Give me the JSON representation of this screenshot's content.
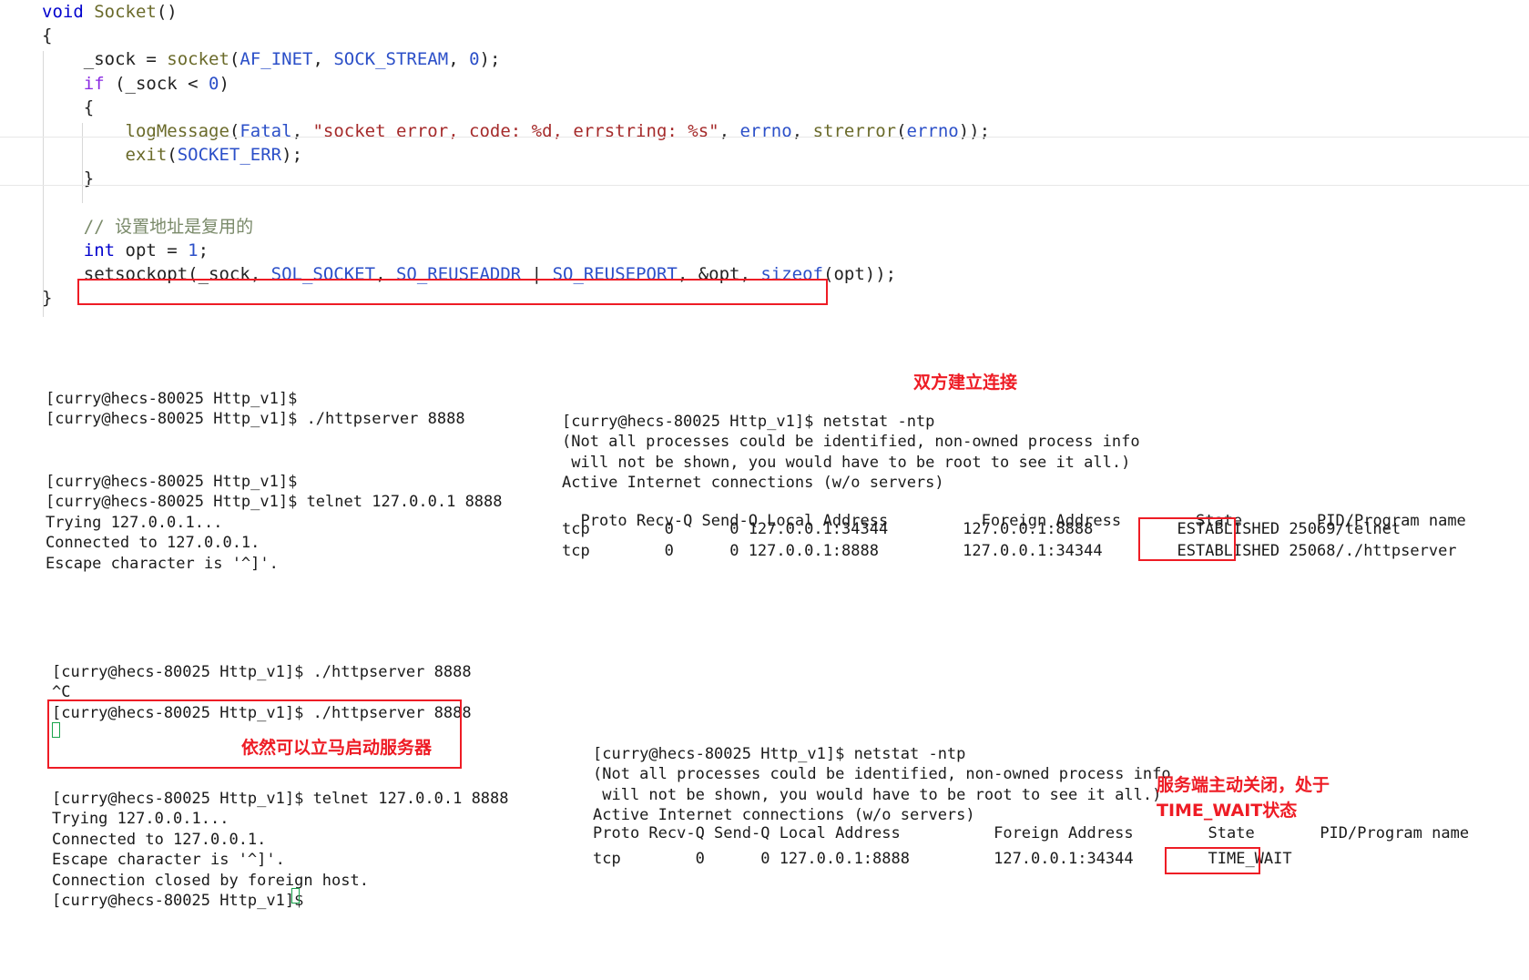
{
  "code": {
    "lines": [
      [
        {
          "t": "void ",
          "c": "kw"
        },
        {
          "t": "Socket",
          "c": "fn"
        },
        {
          "t": "()",
          "c": "punc"
        }
      ],
      [
        {
          "t": "{",
          "c": "punc"
        }
      ],
      [
        {
          "t": "    _sock = ",
          "c": "plain"
        },
        {
          "t": "socket",
          "c": "fn"
        },
        {
          "t": "(",
          "c": "punc"
        },
        {
          "t": "AF_INET",
          "c": "const"
        },
        {
          "t": ", ",
          "c": "punc"
        },
        {
          "t": "SOCK_STREAM",
          "c": "const"
        },
        {
          "t": ", ",
          "c": "punc"
        },
        {
          "t": "0",
          "c": "num"
        },
        {
          "t": ");",
          "c": "punc"
        }
      ],
      [
        {
          "t": "    ",
          "c": "plain"
        },
        {
          "t": "if",
          "c": "kw2"
        },
        {
          "t": " (_sock < ",
          "c": "plain"
        },
        {
          "t": "0",
          "c": "num"
        },
        {
          "t": ")",
          "c": "punc"
        }
      ],
      [
        {
          "t": "    {",
          "c": "punc"
        }
      ],
      [
        {
          "t": "        ",
          "c": "plain"
        },
        {
          "t": "logMessage",
          "c": "fn"
        },
        {
          "t": "(",
          "c": "punc"
        },
        {
          "t": "Fatal",
          "c": "const"
        },
        {
          "t": ", ",
          "c": "punc"
        },
        {
          "t": "\"socket error, code: %d, errstring: %s\"",
          "c": "str"
        },
        {
          "t": ", ",
          "c": "punc"
        },
        {
          "t": "errno",
          "c": "const"
        },
        {
          "t": ", ",
          "c": "punc"
        },
        {
          "t": "strerror",
          "c": "fn"
        },
        {
          "t": "(",
          "c": "punc"
        },
        {
          "t": "errno",
          "c": "const"
        },
        {
          "t": "));",
          "c": "punc"
        }
      ],
      [
        {
          "t": "        ",
          "c": "plain"
        },
        {
          "t": "exit",
          "c": "fn"
        },
        {
          "t": "(",
          "c": "punc"
        },
        {
          "t": "SOCKET_ERR",
          "c": "const"
        },
        {
          "t": ");",
          "c": "punc"
        }
      ],
      [
        {
          "t": "    }",
          "c": "punc"
        }
      ],
      [
        {
          "t": "",
          "c": "plain"
        }
      ],
      [
        {
          "t": "    // 设置地址是复用的",
          "c": "comment"
        }
      ],
      [
        {
          "t": "    ",
          "c": "plain"
        },
        {
          "t": "int",
          "c": "kw"
        },
        {
          "t": " opt = ",
          "c": "plain"
        },
        {
          "t": "1",
          "c": "num"
        },
        {
          "t": ";",
          "c": "punc"
        }
      ],
      [
        {
          "t": "    ",
          "c": "plain"
        },
        {
          "t": "setsockopt",
          "c": "plain"
        },
        {
          "t": "(_sock, ",
          "c": "punc"
        },
        {
          "t": "SOL_SOCKET",
          "c": "const"
        },
        {
          "t": ", ",
          "c": "punc"
        },
        {
          "t": "SO_REUSEADDR",
          "c": "const"
        },
        {
          "t": " | ",
          "c": "punc"
        },
        {
          "t": "SO_REUSEPORT",
          "c": "const"
        },
        {
          "t": ", &opt, ",
          "c": "punc"
        },
        {
          "t": "sizeof",
          "c": "const"
        },
        {
          "t": "(opt));",
          "c": "punc"
        }
      ],
      [
        {
          "t": "}",
          "c": "punc"
        }
      ]
    ]
  },
  "terminals": {
    "server_start": "[curry@hecs-80025 Http_v1]$\n[curry@hecs-80025 Http_v1]$ ./httpserver 8888",
    "telnet_client": "[curry@hecs-80025 Http_v1]$\n[curry@hecs-80025 Http_v1]$ telnet 127.0.0.1 8888\nTrying 127.0.0.1...\nConnected to 127.0.0.1.\nEscape character is '^]'.",
    "netstat_top": "[curry@hecs-80025 Http_v1]$ netstat -ntp\n(Not all processes could be identified, non-owned process info\n will not be shown, you would have to be root to see it all.)\nActive Internet connections (w/o servers)",
    "netstat_top_header": "Proto Recv-Q Send-Q Local Address          Foreign Address        State        PID/Program name",
    "netstat_top_rows": [
      "tcp        0      0 127.0.0.1:34344        127.0.0.1:8888         ESTABLISHED 25069/telnet",
      "tcp        0      0 127.0.0.1:8888         127.0.0.1:34344        ESTABLISHED 25068/./httpserver"
    ],
    "restart_block": "[curry@hecs-80025 Http_v1]$ ./httpserver 8888\n^C\n[curry@hecs-80025 Http_v1]$ ./httpserver 8888",
    "final_client": "[curry@hecs-80025 Http_v1]$ telnet 127.0.0.1 8888\nTrying 127.0.0.1...\nConnected to 127.0.0.1.\nEscape character is '^]'.\nConnection closed by foreign host.\n[curry@hecs-80025 Http_v1]$",
    "netstat_bottom": "[curry@hecs-80025 Http_v1]$ netstat -ntp\n(Not all processes could be identified, non-owned process info\n will not be shown, you would have to be root to see it all.)\nActive Internet connections (w/o servers)",
    "netstat_bottom_header": "Proto Recv-Q Send-Q Local Address          Foreign Address        State       PID/Program name",
    "netstat_bottom_row": "tcp        0      0 127.0.0.1:8888         127.0.0.1:34344        TIME_WAIT"
  },
  "annotations": {
    "connection_established": "双方建立连接",
    "restart_immediately": "依然可以立马启动服务器",
    "time_wait": "服务端主动关闭，处于\nTIME_WAIT状态"
  },
  "colors": {
    "highlight_red": "#ee1c25",
    "cursor_green": "#16a34a",
    "keyword_blue": "#0000cd",
    "string_brown": "#a52a2a",
    "comment_green": "#7a8a6a"
  }
}
